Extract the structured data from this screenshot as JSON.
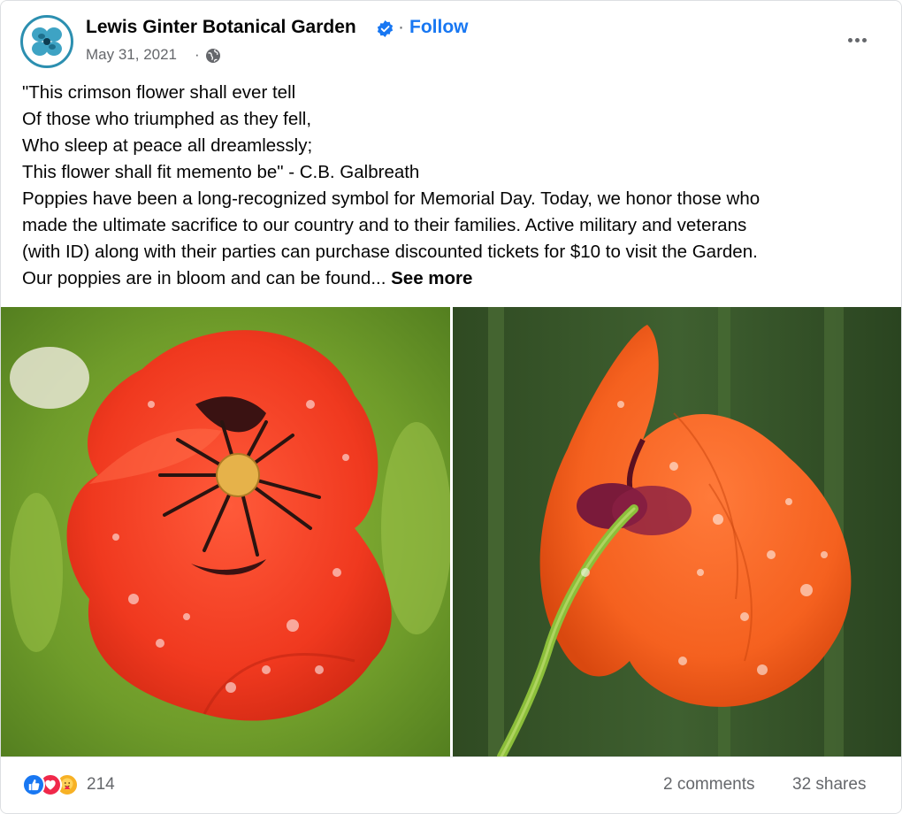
{
  "header": {
    "page_name": "Lewis Ginter Botanical Garden",
    "separator": "·",
    "follow_label": "Follow",
    "date": "May 31, 2021",
    "date_separator": "·",
    "avatar_icon": "botanical-garden-logo-icon",
    "verified_icon": "verified-badge-icon",
    "audience_icon": "globe-icon",
    "menu_icon": "more-options-icon"
  },
  "post": {
    "lines": [
      "\"This crimson flower shall ever tell",
      "Of those who triumphed as they fell,",
      "Who sleep at peace all dreamlessly;",
      "This flower shall fit memento be\" - C.B. Galbreath",
      "Poppies have been a long-recognized symbol for Memorial Day. Today, we honor those who",
      "made the ultimate sacrifice to our country and to their families. Active military and veterans",
      "(with ID) along with their parties can purchase discounted tickets for $10 to visit the Garden.",
      "Our poppies are in bloom and can be found..."
    ],
    "see_more_label": "See more"
  },
  "photos": [
    {
      "subject": "red-poppy-front-photo"
    },
    {
      "subject": "orange-poppy-side-photo"
    }
  ],
  "footer": {
    "reaction_icons": [
      "like-reaction-icon",
      "love-reaction-icon",
      "care-reaction-icon"
    ],
    "reaction_count": "214",
    "comments_label": "2 comments",
    "shares_label": "32 shares"
  },
  "colors": {
    "link_blue": "#1877f2",
    "secondary_text": "#65676b",
    "love_red": "#f0284a",
    "care_yellow": "#f7b125"
  }
}
